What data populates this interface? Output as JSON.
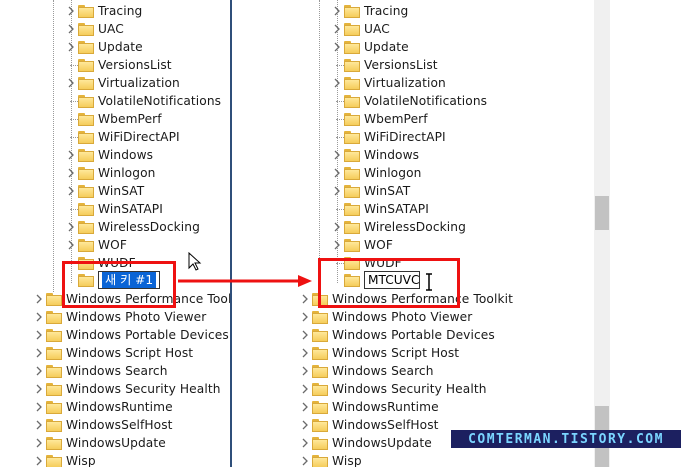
{
  "left_tree": {
    "nested": [
      {
        "label": "Tracing",
        "expand": true
      },
      {
        "label": "UAC",
        "expand": true
      },
      {
        "label": "Update",
        "expand": true
      },
      {
        "label": "VersionsList",
        "expand": false
      },
      {
        "label": "Virtualization",
        "expand": true
      },
      {
        "label": "VolatileNotifications",
        "expand": false
      },
      {
        "label": "WbemPerf",
        "expand": false
      },
      {
        "label": "WiFiDirectAPI",
        "expand": false
      },
      {
        "label": "Windows",
        "expand": true
      },
      {
        "label": "Winlogon",
        "expand": true
      },
      {
        "label": "WinSAT",
        "expand": true
      },
      {
        "label": "WinSATAPI",
        "expand": false
      },
      {
        "label": "WirelessDocking",
        "expand": true
      },
      {
        "label": "WOF",
        "expand": true
      },
      {
        "label": "WUDF",
        "expand": false
      }
    ],
    "new_key_label": "새 키 #1",
    "top_level": [
      "Windows Performance Toolkit",
      "Windows Photo Viewer",
      "Windows Portable Devices",
      "Windows Script Host",
      "Windows Search",
      "Windows Security Health",
      "WindowsRuntime",
      "WindowsSelfHost",
      "WindowsUpdate",
      "Wisp"
    ]
  },
  "right_tree": {
    "nested": [
      {
        "label": "Tracing",
        "expand": true
      },
      {
        "label": "UAC",
        "expand": true
      },
      {
        "label": "Update",
        "expand": true
      },
      {
        "label": "VersionsList",
        "expand": false
      },
      {
        "label": "Virtualization",
        "expand": true
      },
      {
        "label": "VolatileNotifications",
        "expand": false
      },
      {
        "label": "WbemPerf",
        "expand": false
      },
      {
        "label": "WiFiDirectAPI",
        "expand": false
      },
      {
        "label": "Windows",
        "expand": true
      },
      {
        "label": "Winlogon",
        "expand": true
      },
      {
        "label": "WinSAT",
        "expand": true
      },
      {
        "label": "WinSATAPI",
        "expand": false
      },
      {
        "label": "WirelessDocking",
        "expand": true
      },
      {
        "label": "WOF",
        "expand": true
      },
      {
        "label": "WUDF",
        "expand": false
      }
    ],
    "edit_value": "MTCUVC",
    "top_level": [
      "Windows Performance Toolkit",
      "Windows Photo Viewer",
      "Windows Portable Devices",
      "Windows Script Host",
      "Windows Search",
      "Windows Security Health",
      "WindowsRuntime",
      "WindowsSelfHost",
      "WindowsUpdate",
      "Wisp"
    ]
  },
  "watermark": "COMTERMAN.TISTORY.COM",
  "colors": {
    "highlight_box": "#ee1111",
    "arrow": "#ee1111",
    "selection": "#0a64d6",
    "folder": "#f5cc5a",
    "watermark_bg": "#1c2060",
    "watermark_text": "#7ad5ff"
  },
  "icons": [
    "chevron-right-icon",
    "folder-icon",
    "arrow-right-icon",
    "mouse-cursor-icon",
    "text-cursor-icon"
  ]
}
